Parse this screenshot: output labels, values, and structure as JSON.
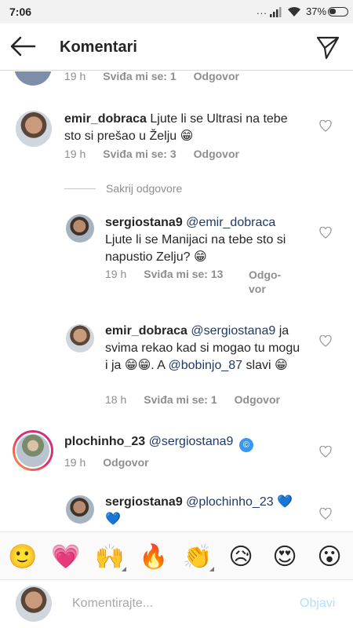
{
  "status_bar": {
    "time": "7:06",
    "dots": "...",
    "battery": "37%"
  },
  "header": {
    "title": "Komentari",
    "back_icon": "arrow-left-icon",
    "send_icon": "paper-plane-icon"
  },
  "comments": [
    {
      "time": "19 h",
      "likes": "Sviđa mi se: 1",
      "reply": "Odgovor"
    },
    {
      "user": "emir_dobraca",
      "text": "Ljute li se Ultrasi na tebe sto si prešao u Želju 😁",
      "time": "19 h",
      "likes": "Sviđa mi se: 3",
      "reply": "Odgovor"
    },
    {
      "user": "sergiostana9",
      "mention": "@emir_dobraca",
      "text": "Ljute li se Manijaci na tebe sto si napustio Zelju? 😁",
      "time": "19 h",
      "likes": "Sviđa mi se: 13",
      "reply_line1": "Odgo-",
      "reply_line2": "vor"
    },
    {
      "user": "emir_dobraca",
      "mention": "@sergiostana9",
      "text_a": "ja svima rekao kad si mogao tu mogu i ja 😁😁. A",
      "mention2": "@bobinjo_87",
      "text_b": "slavi 😁",
      "time": "18 h",
      "likes": "Sviđa mi se: 1",
      "reply": "Odgovor"
    },
    {
      "user": "plochinho_23",
      "mention": "@sergiostana9",
      "emoji": "©",
      "time": "19 h",
      "reply": "Odgovor"
    },
    {
      "user": "sergiostana9",
      "mention": "@plochinho_23",
      "emoji_a": "💙",
      "emoji_b": "💙"
    }
  ],
  "hide_replies": "Sakrij odgovore",
  "emoji_bar": [
    "🙂",
    "💗",
    "🙌",
    "🔥",
    "👏",
    "😥",
    "😍",
    "😮"
  ],
  "composer": {
    "placeholder": "Komentirajte...",
    "post": "Objavi"
  }
}
